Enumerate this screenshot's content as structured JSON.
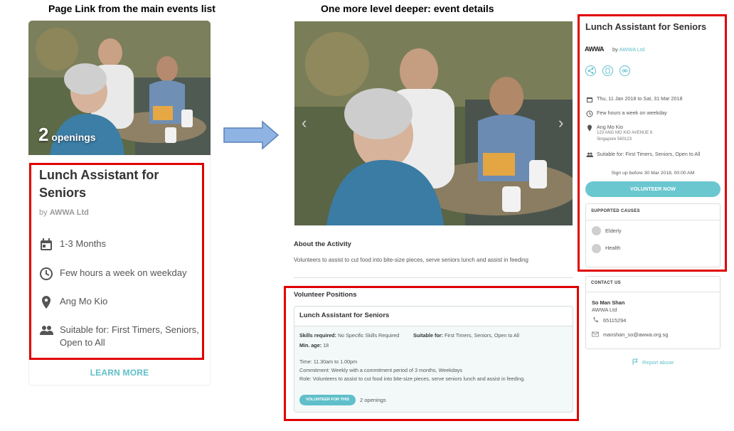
{
  "captions": {
    "left": "Page Link from the main events list",
    "right": "One more level deeper: event details"
  },
  "list_card": {
    "openings_number": "2",
    "openings_label": "openings",
    "title": "Lunch Assistant for Seniors",
    "by_prefix": "by",
    "org": "AWWA Ltd",
    "duration": "1-3 Months",
    "frequency": "Few hours a week on weekday",
    "location": "Ang Mo Kio",
    "suitable": "Suitable for: First Timers, Seniors, Open to All",
    "learn_more": "LEARN MORE"
  },
  "detail": {
    "about_heading": "About the Activity",
    "about_text": "Volunteers to assist to cut food into bite-size pieces, serve seniors lunch and assist in feeding",
    "positions_heading": "Volunteer Positions",
    "position": {
      "title": "Lunch Assistant for Seniors",
      "skills_label": "Skills required:",
      "skills_value": "No Specific Skills Required",
      "suitable_label": "Suitable for:",
      "suitable_value": "First Timers, Seniors, Open to All",
      "min_age_label": "Min. age:",
      "min_age_value": "18",
      "time": "Time: 11.30am to 1.00pm",
      "commitment": "Commitment: Weekly with a commitment period of 3 months, Weekdays",
      "role": "Role: Volunteers to assist to cut food into bite-size pieces, serve seniors lunch and assist in feeding.",
      "button": "VOLUNTEER FOR THIS",
      "openings": "2 openings"
    }
  },
  "sidebar": {
    "title": "Lunch Assistant for Seniors",
    "logo_text": "AWWA",
    "by_prefix": "by",
    "org": "AWWA Ltd",
    "dates": "Thu, 11 Jan 2018 to Sat, 31 Mar 2018",
    "frequency": "Few hours a week on weekday",
    "location": "Ang Mo Kio",
    "address_line1": "123 ANG MO KIO AVENUE 6",
    "address_line2": "Singapore 560123",
    "suitable": "Suitable for: First Timers, Seniors, Open to All",
    "signup": "Sign up before 30 Mar 2018, 00:00 AM",
    "volunteer_now": "VOLUNTEER NOW",
    "causes_heading": "SUPPORTED CAUSES",
    "causes": [
      "Elderly",
      "Health"
    ],
    "contact_heading": "CONTACT US",
    "contact_name": "So Man Shan",
    "contact_org": "AWWA Ltd",
    "contact_phone": "65115294",
    "contact_email": "manshan_so@awwa.org.sg",
    "report": "Report abuse"
  },
  "colors": {
    "accent": "#5fbfca",
    "highlight_border": "#e00000",
    "arrow_fill": "#8fb4e3"
  }
}
